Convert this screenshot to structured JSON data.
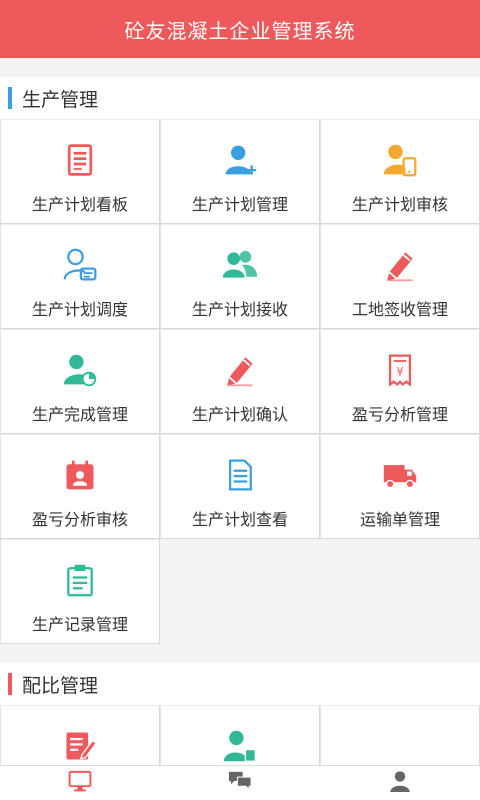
{
  "header": {
    "title": "砼友混凝土企业管理系统"
  },
  "colors": {
    "header_bg": "#ee5a5c",
    "section1_bar": "#3a9fe0",
    "section2_bar": "#ee5a5c"
  },
  "sections": [
    {
      "title": "生产管理",
      "items": [
        {
          "label": "生产计划看板",
          "icon": "document-list-icon",
          "color": "#ee5a5c"
        },
        {
          "label": "生产计划管理",
          "icon": "user-add-icon",
          "color": "#3a9fe0"
        },
        {
          "label": "生产计划审核",
          "icon": "user-phone-icon",
          "color": "#f3a830"
        },
        {
          "label": "生产计划调度",
          "icon": "user-card-icon",
          "color": "#3a9fe0"
        },
        {
          "label": "生产计划接收",
          "icon": "users-icon",
          "color": "#2fb996"
        },
        {
          "label": "工地签收管理",
          "icon": "pencil-icon",
          "color": "#ee5a5c"
        },
        {
          "label": "生产完成管理",
          "icon": "user-chart-icon",
          "color": "#2fb996"
        },
        {
          "label": "生产计划确认",
          "icon": "pencil-icon",
          "color": "#ee5a5c"
        },
        {
          "label": "盈亏分析管理",
          "icon": "receipt-icon",
          "color": "#ee5a5c"
        },
        {
          "label": "盈亏分析审核",
          "icon": "calendar-user-icon",
          "color": "#ee5a5c"
        },
        {
          "label": "生产计划查看",
          "icon": "document-icon",
          "color": "#3a9fe0"
        },
        {
          "label": "运输单管理",
          "icon": "truck-icon",
          "color": "#ee5a5c"
        },
        {
          "label": "生产记录管理",
          "icon": "clipboard-icon",
          "color": "#2fb996"
        }
      ]
    },
    {
      "title": "配比管理",
      "items": [
        {
          "label": "",
          "icon": "document-edit-icon",
          "color": "#ee5a5c"
        },
        {
          "label": "",
          "icon": "user-doc-icon",
          "color": "#2fb996"
        },
        {
          "label": "",
          "icon": "",
          "color": ""
        }
      ]
    }
  ],
  "tabbar": [
    {
      "icon": "monitor-icon",
      "color": "#ee5a5c"
    },
    {
      "icon": "chat-icon",
      "color": "#666666"
    },
    {
      "icon": "person-icon",
      "color": "#666666"
    }
  ]
}
